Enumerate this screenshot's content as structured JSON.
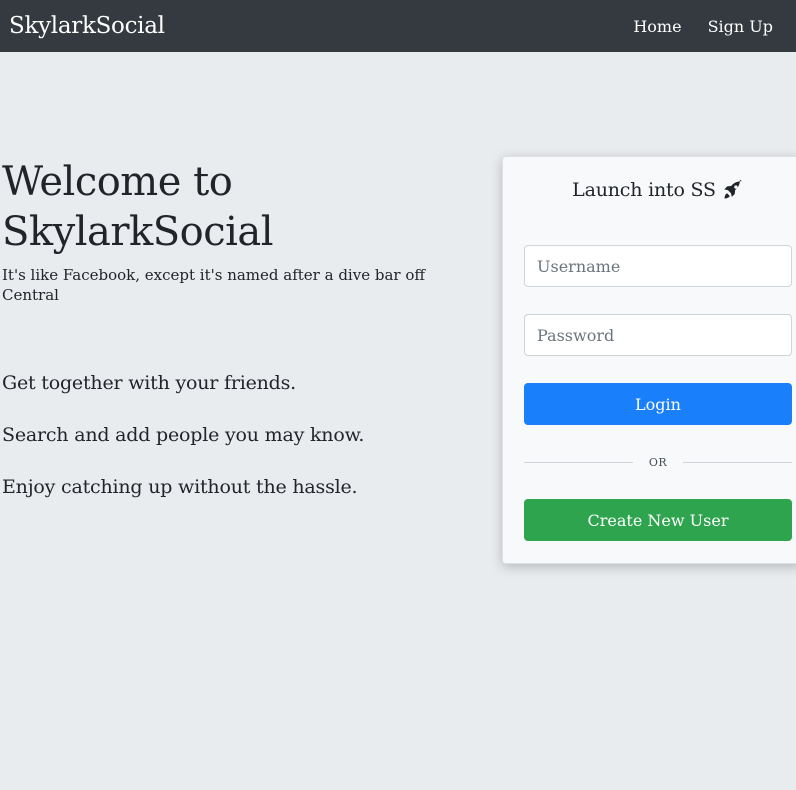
{
  "navbar": {
    "brand": "SkylarkSocial",
    "links": [
      {
        "label": "Home"
      },
      {
        "label": "Sign Up"
      }
    ]
  },
  "hero": {
    "title_line1": "Welcome to",
    "title_line2": "SkylarkSocial",
    "subtitle": "It's like Facebook, except it's named after a dive bar off Central"
  },
  "features": [
    "Get together with your friends.",
    "Search and add people you may know.",
    "Enjoy catching up without the hassle."
  ],
  "login_card": {
    "title": "Launch into SS",
    "title_icon": "rocket-icon",
    "username_placeholder": "Username",
    "password_placeholder": "Password",
    "login_label": "Login",
    "divider_label": "OR",
    "create_label": "Create New User"
  },
  "colors": {
    "navbar_bg": "#343a40",
    "page_bg": "#e9ecef",
    "login_button": "#1a7ffb",
    "create_button": "#2ea44f"
  }
}
